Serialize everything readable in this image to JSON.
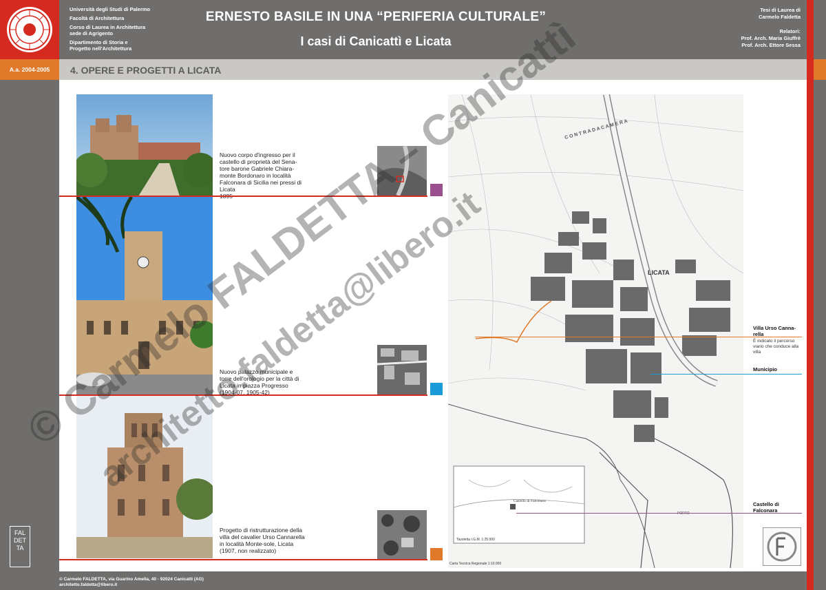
{
  "header": {
    "university": "Università degli Studi di Palermo",
    "faculty": "Facoltà di Architettura",
    "course_line1": "Corso di Laurea in Architettura",
    "course_line2": "sede di Agrigento",
    "department_line1": "Dipartimento di Storia e",
    "department_line2": "Progetto nell'Architettura",
    "title": "ERNESTO BASILE IN UNA “PERIFERIA CULTURALE”",
    "subtitle": "I casi di Canicattì e Licata",
    "thesis_line1": "Tesi di Laurea di",
    "thesis_line2": "Carmelo Faldetta",
    "advisors_label": "Relatori:",
    "advisor1": "Prof. Arch. Maria Giuffrè",
    "advisor2": "Prof. Arch. Ettore Sessa",
    "year": "A.a. 2004-2005"
  },
  "section": {
    "title": "4. OPERE E PROGETTI A LICATA"
  },
  "works": [
    {
      "caption": "Nuovo corpo d'ingresso per il castello di proprietà del Sena-tore barone Gabriele Chiara-monte Bordonaro in località Falconara di Sicilia nei pressi di Licata\n1895",
      "color": "#9a4f8f"
    },
    {
      "caption": "Nuovo palazzo municipale e torre dell'orologio per la città di Licata in piazza Progresso\n(1904-07, 1905-42)",
      "color": "#1a9ad8"
    },
    {
      "caption": "Progetto di ristrutturazione della villa del cavalier Urso Cannarella in località Monte-sole, Licata\n(1907, non realizzato)",
      "color": "#e07a2a"
    }
  ],
  "map": {
    "city_label": "LICATA",
    "contrada_label": "C O N T R A D A   C A M E R A",
    "porto_label": "PORTO",
    "inset_label": "Castello di Falconara",
    "inset_caption": "Tavoletta I.G.M. 1:25.000",
    "caption": "Carta Tecnica Regionale 1:10.000"
  },
  "legend": {
    "villa_title": "Villa Urso Canna-rella",
    "villa_note": "È indicato il percorso viario che conduce alla villa",
    "municipio": "Municipio",
    "castello_line1": "Castello di",
    "castello_line2": "Falconara"
  },
  "side_logo": "FAL DET TA",
  "footer": {
    "line1": "© Carmelo FALDETTA, via Guarino Amella, 40 - 92024 Canicattì (AG)",
    "line2": "architetto.faldetta@libero.it"
  },
  "watermark": {
    "line1": "© Carmelo FALDETTA – Canicattì",
    "line2": "architetto.faldetta@libero.it"
  },
  "colors": {
    "red": "#d42a20",
    "grey": "#6f6e6c",
    "orange": "#e07a2a",
    "blue": "#1a9ad8",
    "purple": "#9a4f8f"
  }
}
